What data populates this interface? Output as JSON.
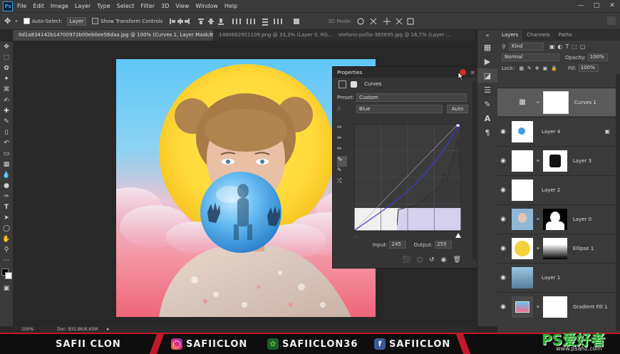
{
  "menu": {
    "logo": "Ps",
    "items": [
      "File",
      "Edit",
      "Image",
      "Layer",
      "Type",
      "Select",
      "Filter",
      "3D",
      "View",
      "Window",
      "Help"
    ]
  },
  "options": {
    "auto_select_label": "Auto-Select:",
    "auto_select_value": "Layer",
    "transform_label": "Show Transform Controls",
    "mode_label": "3D Mode:"
  },
  "tabs": [
    {
      "label": "0d1a834142b14700972b00eb0ee56daa.jpg @ 100% (Curves 1, Layer Mask/8) *",
      "active": true
    },
    {
      "label": "1480662951109.png @ 33,3% (Layer 0, RG...",
      "active": false
    },
    {
      "label": "stefano-pollio-365695.jpg @ 16,7% (Layer ...",
      "active": false
    }
  ],
  "properties": {
    "title": "Properties",
    "type_label": "Curves",
    "preset_label": "Preset:",
    "preset_value": "Custom",
    "channel_value": "Blue",
    "auto_label": "Auto",
    "input_label": "Input:",
    "input_value": "245",
    "output_label": "Output:",
    "output_value": "255"
  },
  "layers_panel": {
    "tabs": [
      "Layers",
      "Channels",
      "Paths"
    ],
    "kind_label": "Kind",
    "blend_mode": "Normal",
    "opacity_label": "Opacity:",
    "opacity_value": "100%",
    "lock_label": "Lock:",
    "fill_label": "Fill:",
    "fill_value": "100%",
    "layers": [
      {
        "name": "Curves 1"
      },
      {
        "name": "Layer 4"
      },
      {
        "name": "Layer 3"
      },
      {
        "name": "Layer 2"
      },
      {
        "name": "Layer 0"
      },
      {
        "name": "Ellipse 1"
      },
      {
        "name": "Layer 1"
      },
      {
        "name": "Gradient Fill 1"
      }
    ]
  },
  "status": {
    "zoom": "100%",
    "doc": "Doc: 931,9K/6,65M"
  },
  "banner": {
    "name": "SAFII CLON",
    "instagram": "SAFIICLON",
    "envato": "SAFIICLON36",
    "facebook": "SAFIICLON",
    "watermark_site": "www.psahz.com",
    "watermark_logo": "PS爱好者"
  },
  "colors": {
    "accent_red": "#c0192b",
    "panel_bg": "#3a3a3a",
    "curve_fill": "#d9d6f2"
  }
}
